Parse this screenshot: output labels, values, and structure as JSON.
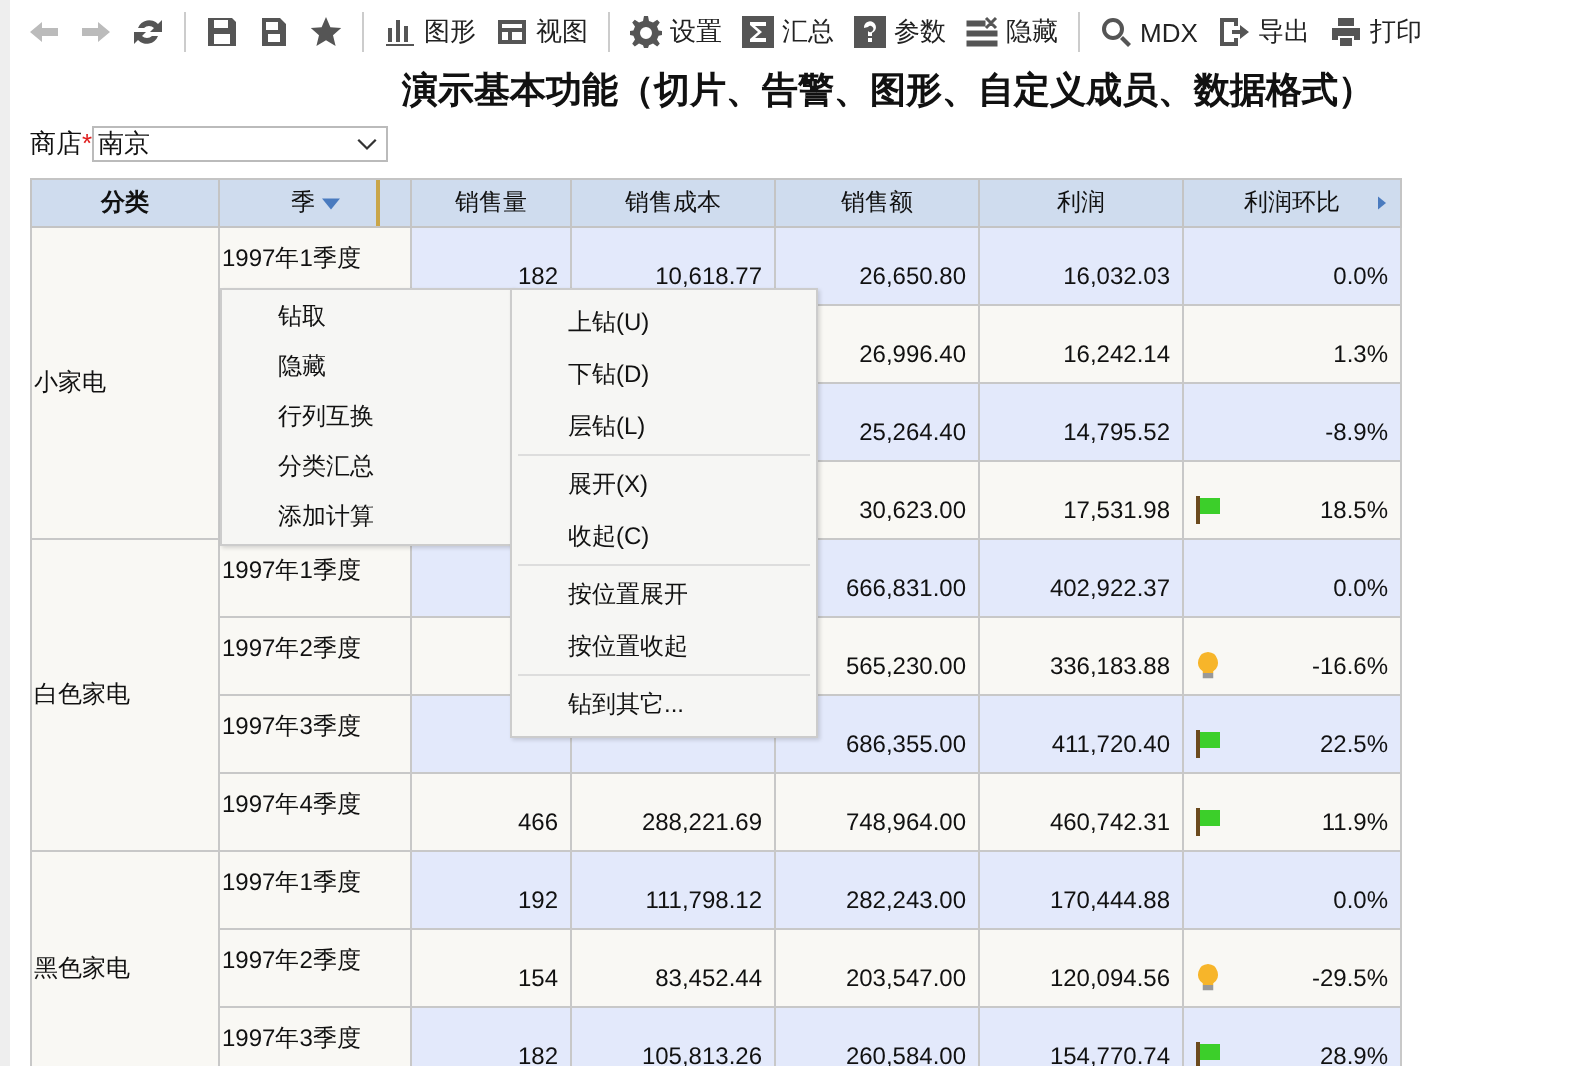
{
  "toolbar": [
    {
      "kind": "back",
      "disabled": true
    },
    {
      "kind": "forward",
      "disabled": true
    },
    {
      "kind": "refresh",
      "disabled": false
    },
    {
      "kind": "sep"
    },
    {
      "kind": "save",
      "disabled": false
    },
    {
      "kind": "saveas",
      "disabled": false
    },
    {
      "kind": "star",
      "disabled": false
    },
    {
      "kind": "sep"
    },
    {
      "kind": "chart",
      "label": "图形",
      "disabled": false
    },
    {
      "kind": "view",
      "label": "视图",
      "disabled": false
    },
    {
      "kind": "sep"
    },
    {
      "kind": "gear",
      "label": "设置",
      "disabled": false
    },
    {
      "kind": "sigma",
      "label": "汇总",
      "disabled": false
    },
    {
      "kind": "help",
      "label": "参数",
      "disabled": false
    },
    {
      "kind": "hide",
      "label": "隐藏",
      "disabled": false
    },
    {
      "kind": "sep"
    },
    {
      "kind": "search",
      "label": "MDX",
      "disabled": false
    },
    {
      "kind": "export",
      "label": "导出",
      "disabled": false
    },
    {
      "kind": "print",
      "label": "打印",
      "disabled": false
    }
  ],
  "title": "演示基本功能（切片、告警、图形、自定义成员、数据格式）",
  "filter": {
    "label": "商店",
    "required_mark": "*",
    "value": "南京"
  },
  "table": {
    "columns": [
      "分类",
      "季",
      "销售量",
      "销售成本",
      "销售额",
      "利润",
      "利润环比"
    ],
    "groups": [
      {
        "category": "小家电",
        "rows": [
          {
            "quarter": "1997年1季度",
            "qty": "182",
            "cost": "10,618.77",
            "sales": "26,650.80",
            "profit": "16,032.03",
            "flag": false,
            "bulb": false,
            "ratio": "0.0%"
          },
          {
            "quarter": null,
            "qty": null,
            "cost": null,
            "sales": "26,996.40",
            "profit": "16,242.14",
            "flag": false,
            "bulb": false,
            "ratio": "1.3%"
          },
          {
            "quarter": null,
            "qty": null,
            "cost": null,
            "sales": "25,264.40",
            "profit": "14,795.52",
            "flag": false,
            "bulb": false,
            "ratio": "-8.9%"
          },
          {
            "quarter": null,
            "qty": null,
            "cost": null,
            "sales": "30,623.00",
            "profit": "17,531.98",
            "flag": true,
            "bulb": false,
            "ratio": "18.5%"
          }
        ]
      },
      {
        "category": "白色家电",
        "rows": [
          {
            "quarter": "1997年1季度",
            "qty": null,
            "cost": null,
            "sales": "666,831.00",
            "profit": "402,922.37",
            "flag": false,
            "bulb": false,
            "ratio": "0.0%"
          },
          {
            "quarter": "1997年2季度",
            "qty": null,
            "cost": null,
            "sales": "565,230.00",
            "profit": "336,183.88",
            "flag": false,
            "bulb": true,
            "ratio": "-16.6%"
          },
          {
            "quarter": "1997年3季度",
            "qty": null,
            "cost": null,
            "sales": "686,355.00",
            "profit": "411,720.40",
            "flag": true,
            "bulb": false,
            "ratio": "22.5%"
          },
          {
            "quarter": "1997年4季度",
            "qty": "466",
            "cost": "288,221.69",
            "sales": "748,964.00",
            "profit": "460,742.31",
            "flag": true,
            "bulb": false,
            "ratio": "11.9%"
          }
        ]
      },
      {
        "category": "黑色家电",
        "rows": [
          {
            "quarter": "1997年1季度",
            "qty": "192",
            "cost": "111,798.12",
            "sales": "282,243.00",
            "profit": "170,444.88",
            "flag": false,
            "bulb": false,
            "ratio": "0.0%"
          },
          {
            "quarter": "1997年2季度",
            "qty": "154",
            "cost": "83,452.44",
            "sales": "203,547.00",
            "profit": "120,094.56",
            "flag": false,
            "bulb": true,
            "ratio": "-29.5%"
          },
          {
            "quarter": "1997年3季度",
            "qty": "182",
            "cost": "105,813.26",
            "sales": "260,584.00",
            "profit": "154,770.74",
            "flag": true,
            "bulb": false,
            "ratio": "28.9%"
          }
        ]
      }
    ]
  },
  "context_menu": {
    "items": [
      "钻取",
      "隐藏",
      "行列互换",
      "分类汇总",
      "添加计算"
    ]
  },
  "submenu": {
    "groups": [
      [
        "上钻(U)",
        "下钻(D)",
        "层钻(L)"
      ],
      [
        "展开(X)",
        "收起(C)"
      ],
      [
        "按位置展开",
        "按位置收起"
      ],
      [
        "钻到其它..."
      ]
    ]
  }
}
